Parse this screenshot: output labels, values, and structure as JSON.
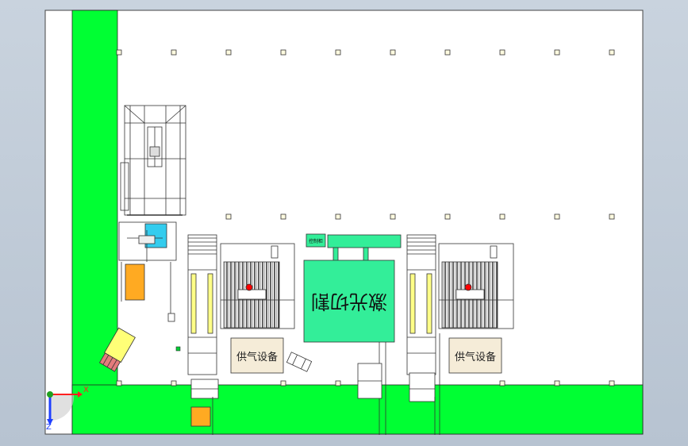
{
  "viewport": {
    "background_top": "#c9d3de",
    "background_bottom": "#b7c3d1",
    "sheet_color": "#ffffff",
    "floor_color": "#00ff33"
  },
  "layout_labels": {
    "gas_supply_left": "供气设备",
    "gas_supply_right": "供气设备",
    "laser_cutting": "激光切割",
    "small_tag": "控制柜"
  },
  "triad": {
    "x_label": "X",
    "z_label": "Z",
    "x_color": "#ff2020",
    "y_color": "#20a020",
    "z_color": "#2040ff"
  },
  "colors": {
    "laser_body": "#33ee99",
    "conveyor_stripe": "#ffff88",
    "orange_unit": "#ffaa22",
    "cyan_unit": "#33ccee",
    "gas_box": "#f5ecd8",
    "red_dot": "#ff0000"
  },
  "icons": {
    "triad": "coordinate-triad-icon",
    "forklift": "forklift-icon"
  }
}
